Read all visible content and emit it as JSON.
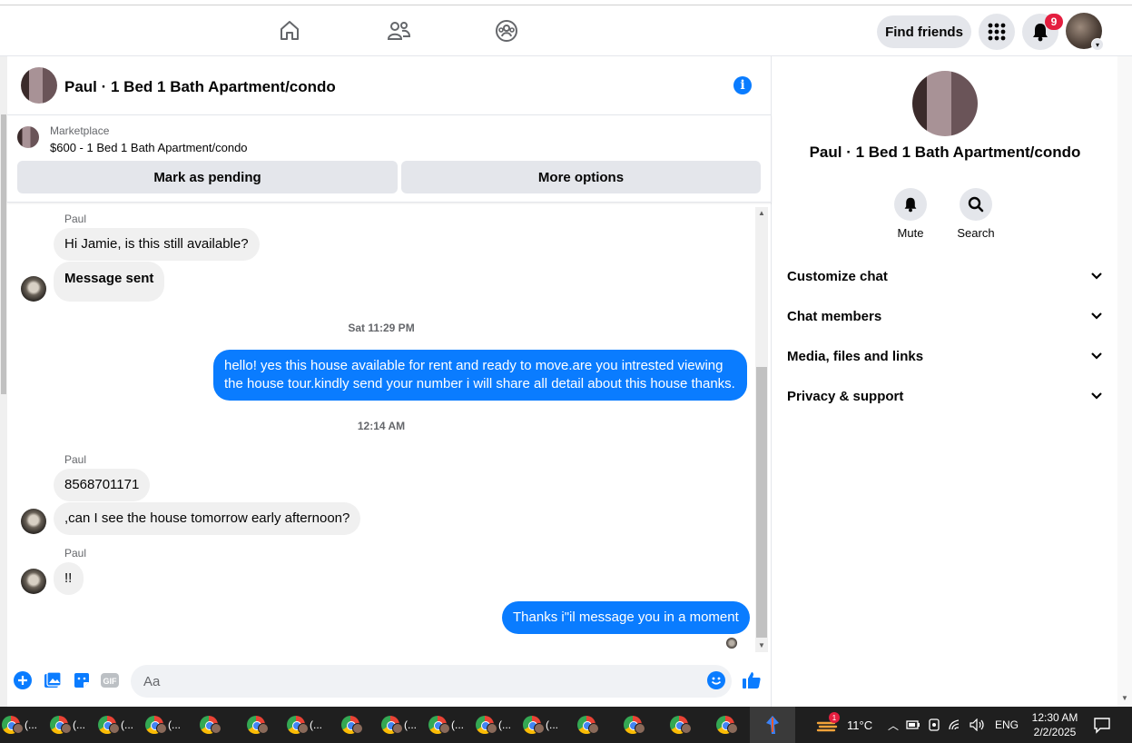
{
  "topbar": {
    "find_friends": "Find friends",
    "notif_count": "9"
  },
  "chat": {
    "title": "Paul · 1 Bed 1 Bath Apartment/condo",
    "marketplace_label": "Marketplace",
    "listing": "$600 - 1 Bed 1 Bath Apartment/condo",
    "pending_btn": "Mark as pending",
    "more_btn": "More options",
    "messages": {
      "sender1": "Paul",
      "m1": "Hi Jamie, is this still available?",
      "m2": "Message sent",
      "ts1": "Sat 11:29 PM",
      "out1": "hello! yes this house available for rent and ready to move.are you intrested viewing the house tour.kindly send your number i will share all detail about this house thanks.",
      "ts2": "12:14 AM",
      "sender2": "Paul",
      "m3": "8568701171",
      "m4": ",can I see the house tomorrow early afternoon?",
      "sender3": "Paul",
      "m5": "!!",
      "out2": "Thanks i\"il message you in a moment"
    },
    "composer_placeholder": "Aa"
  },
  "side": {
    "title": "Paul · 1 Bed 1 Bath Apartment/condo",
    "mute": "Mute",
    "search": "Search",
    "rows": [
      "Customize chat",
      "Chat members",
      "Media, files and links",
      "Privacy & support"
    ]
  },
  "taskbar": {
    "app_label": "(...",
    "temp": "11°C",
    "lang": "ENG",
    "time": "12:30 AM",
    "date": "2/2/2025",
    "weather_badge": "1"
  },
  "colors": {
    "accent": "#0a7cff",
    "bubble_in": "#f0f0f0",
    "badge": "#e41e3f",
    "button_gray": "#e4e6eb"
  }
}
